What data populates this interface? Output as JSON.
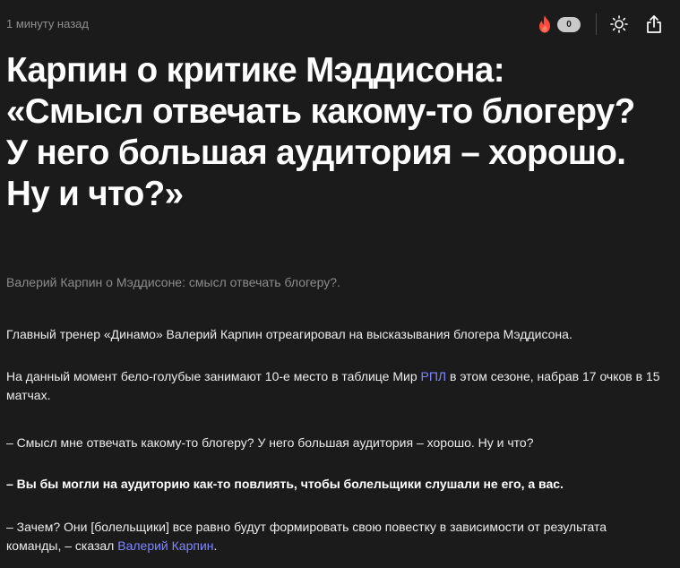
{
  "header": {
    "timestamp": "1 минуту назад",
    "reactions_count": "0",
    "icons": {
      "fire": "fire-icon",
      "theme": "sun-icon",
      "share": "share-icon"
    }
  },
  "article": {
    "title_lines": [
      "Карпин о критике Мэддисона:",
      "«Смысл отвечать какому-то блогеру?",
      "У него большая аудитория – хорошо.",
      "Ну и что?»"
    ],
    "subtitle": "Валерий Карпин о Мэддисоне: смысл отвечать блогеру?.",
    "p1": "Главный тренер «Динамо» Валерий Карпин отреагировал на высказывания блогера Мэддисона.",
    "p2_before": "На данный момент бело-голубые занимают 10-е место в таблице Мир ",
    "p2_link": "РПЛ",
    "p2_after": " в этом сезоне, набрав 17 очков в 15 матчах.",
    "p3": "– Смысл мне отвечать какому-то блогеру? У него большая аудитория – хорошо. Ну и что?",
    "p4": "– Вы бы могли на аудиторию как-то повлиять, чтобы болельщики слушали не его, а вас.",
    "p5_before": "– Зачем? Они [болельщики] все равно будут формировать свою повестку в зависимости от результата команды, – сказал ",
    "p5_link": "Валерий Карпин",
    "p5_after": "."
  },
  "colors": {
    "background": "#1b1b1b",
    "link": "#7e87ff",
    "fire": "#ff4a3d",
    "muted": "#8f8f8f"
  }
}
